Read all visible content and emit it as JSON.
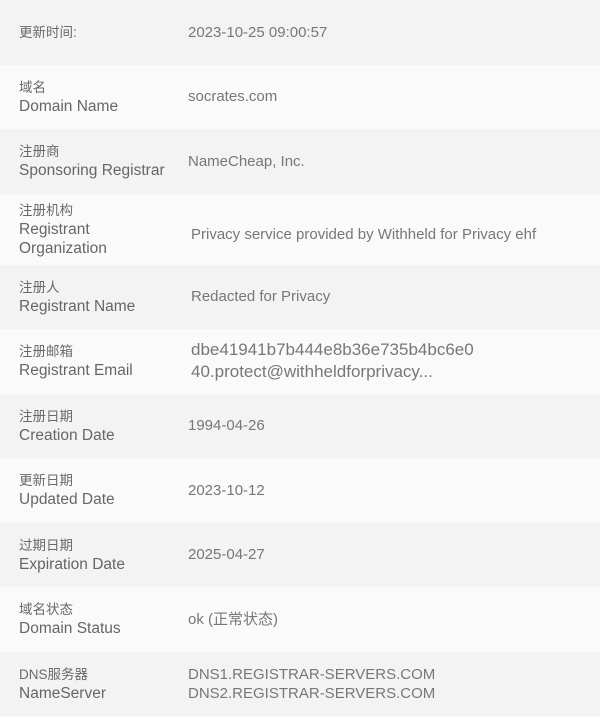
{
  "rows": [
    {
      "cn": "更新时间:",
      "en": "",
      "value": [
        "2023-10-25 09:00:57"
      ]
    },
    {
      "cn": "域名",
      "en": "Domain Name",
      "value": [
        "socrates.com"
      ]
    },
    {
      "cn": "注册商",
      "en": "Sponsoring Registrar",
      "value": [
        "NameCheap, Inc."
      ]
    },
    {
      "cn": "注册机构",
      "en": "Registrant Organization",
      "value": [
        "Privacy service provided by Withheld for Privacy ehf"
      ]
    },
    {
      "cn": "注册人",
      "en": "Registrant Name",
      "value": [
        "Redacted for Privacy"
      ]
    },
    {
      "cn": "注册邮箱",
      "en": "Registrant Email",
      "value": [
        "dbe41941b7b444e8b36e735b4bc6e0",
        "40.protect@withheldforprivacy..."
      ]
    },
    {
      "cn": "注册日期",
      "en": "Creation Date",
      "value": [
        "1994-04-26"
      ]
    },
    {
      "cn": "更新日期",
      "en": "Updated Date",
      "value": [
        "2023-10-12"
      ]
    },
    {
      "cn": "过期日期",
      "en": "Expiration Date",
      "value": [
        "2025-04-27"
      ]
    },
    {
      "cn": "域名状态",
      "en": "Domain Status",
      "value": [
        "ok (正常状态)"
      ]
    },
    {
      "cn": "DNS服务器",
      "en": "NameServer",
      "value": [
        "DNS1.REGISTRAR-SERVERS.COM",
        "DNS2.REGISTRAR-SERVERS.COM"
      ]
    }
  ]
}
